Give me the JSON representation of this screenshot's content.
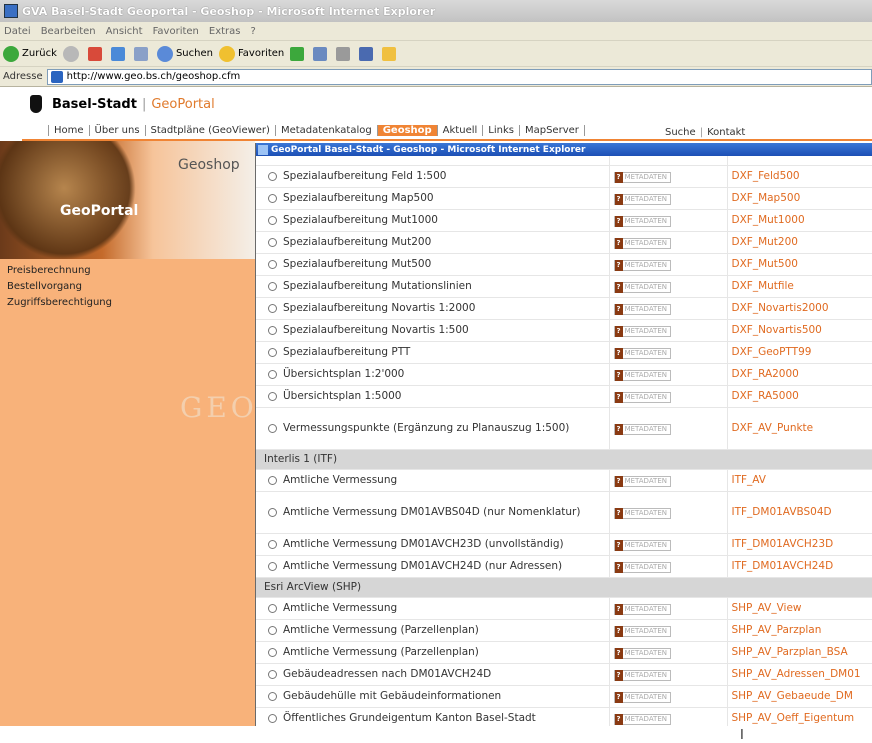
{
  "window": {
    "title": "GVA Basel-Stadt Geoportal - Geoshop - Microsoft Internet Explorer",
    "menu": [
      "Datei",
      "Bearbeiten",
      "Ansicht",
      "Favoriten",
      "Extras",
      "?"
    ],
    "toolbar": {
      "back": "Zurück",
      "search": "Suchen",
      "favorites": "Favoriten"
    },
    "address_label": "Adresse",
    "address_value": "http://www.geo.bs.ch/geoshop.cfm"
  },
  "site": {
    "logo_text": "Basel-Stadt",
    "logo_sub": "GeoPortal",
    "nav": [
      "Home",
      "Über uns",
      "Stadtpläne (GeoViewer)",
      "Metadatenkatalog",
      "Geoshop",
      "Aktuell",
      "Links",
      "MapServer"
    ],
    "nav_right": [
      "Suche",
      "Kontakt"
    ],
    "side_title": "Geoshop",
    "side_brand": "GeoPortal",
    "side_menu": [
      "Preisberechnung",
      "Bestellvorgang",
      "Zugriffsberechtigung"
    ],
    "side_watermark": "GEO"
  },
  "popup": {
    "title": "GeoPortal Basel-Stadt - Geoshop - Microsoft Internet Explorer",
    "meta_label": "METADATEN",
    "meta_q": "?",
    "rows": [
      {
        "type": "item",
        "name": "Spezialaufbereitung Feld 1:500",
        "code": "DXF_Feld500"
      },
      {
        "type": "item",
        "name": "Spezialaufbereitung Map500",
        "code": "DXF_Map500"
      },
      {
        "type": "item",
        "name": "Spezialaufbereitung Mut1000",
        "code": "DXF_Mut1000"
      },
      {
        "type": "item",
        "name": "Spezialaufbereitung Mut200",
        "code": "DXF_Mut200"
      },
      {
        "type": "item",
        "name": "Spezialaufbereitung Mut500",
        "code": "DXF_Mut500"
      },
      {
        "type": "item",
        "name": "Spezialaufbereitung Mutationslinien",
        "code": "DXF_Mutfile"
      },
      {
        "type": "item",
        "name": "Spezialaufbereitung Novartis 1:2000",
        "code": "DXF_Novartis2000"
      },
      {
        "type": "item",
        "name": "Spezialaufbereitung Novartis 1:500",
        "code": "DXF_Novartis500"
      },
      {
        "type": "item",
        "name": "Spezialaufbereitung PTT",
        "code": "DXF_GeoPTT99"
      },
      {
        "type": "item",
        "name": "Übersichtsplan 1:2'000",
        "code": "DXF_RA2000"
      },
      {
        "type": "item",
        "name": "Übersichtsplan 1:5000",
        "code": "DXF_RA5000"
      },
      {
        "type": "tall",
        "name": "Vermessungspunkte (Ergänzung zu Planauszug 1:500)",
        "code": "DXF_AV_Punkte"
      },
      {
        "type": "section",
        "name": "Interlis 1 (ITF)"
      },
      {
        "type": "item",
        "name": "Amtliche Vermessung",
        "code": "ITF_AV"
      },
      {
        "type": "tall",
        "name": "Amtliche Vermessung DM01AVBS04D (nur Nomenklatur)",
        "code": "ITF_DM01AVBS04D"
      },
      {
        "type": "item",
        "name": "Amtliche Vermessung DM01AVCH23D (unvollständig)",
        "code": "ITF_DM01AVCH23D"
      },
      {
        "type": "item",
        "name": "Amtliche Vermessung DM01AVCH24D (nur Adressen)",
        "code": "ITF_DM01AVCH24D"
      },
      {
        "type": "section",
        "name": "Esri ArcView (SHP)"
      },
      {
        "type": "item",
        "name": "Amtliche Vermessung",
        "code": "SHP_AV_View"
      },
      {
        "type": "item",
        "name": "Amtliche Vermessung (Parzellenplan)",
        "code": "SHP_AV_Parzplan"
      },
      {
        "type": "item",
        "name": "Amtliche Vermessung (Parzellenplan)",
        "code": "SHP_AV_Parzplan_BSA"
      },
      {
        "type": "item",
        "name": "Gebäudeadressen nach DM01AVCH24D",
        "code": "SHP_AV_Adressen_DM01"
      },
      {
        "type": "item",
        "name": "Gebäudehülle mit Gebäudeinformationen",
        "code": "SHP_AV_Gebaeude_DM"
      },
      {
        "type": "item",
        "name": "Öffentliches Grundeigentum Kanton Basel-Stadt",
        "code": "SHP_AV_Oeff_Eigentum"
      }
    ]
  },
  "colors": {
    "accent": "#f08434",
    "sidebar": "#f8b27a",
    "link": "#e06a20"
  }
}
